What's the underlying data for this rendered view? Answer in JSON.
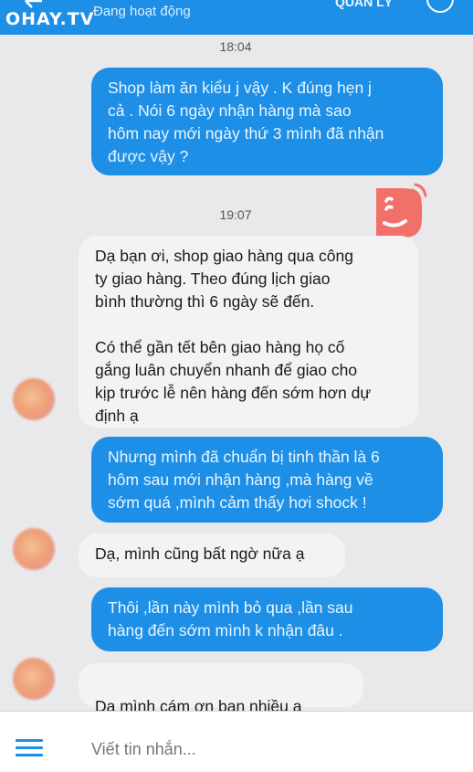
{
  "watermark": "OHAY.TV",
  "header": {
    "status": "Đang hoạt động",
    "manager_label": "QUẢN LÝ"
  },
  "messages": {
    "time1": "18:04",
    "m1": "Shop làm ăn kiểu j vậy . K đúng hẹn j\ncả . Nói 6 ngày nhận hàng mà sao\nhôm nay mới ngày thứ 3 mình đã nhận\nđược vậy ?",
    "time2": "19:07",
    "m2": "Dạ bạn ơi, shop giao hàng qua công\nty giao hàng. Theo đúng lịch giao\nbình thường thì 6 ngày sẽ đến.\n\nCó thể gần tết bên giao hàng họ cố\ngắng luân chuyển nhanh để giao cho\nkịp trước lễ nên hàng đến sớm hơn dự\nđịnh ạ",
    "m3": "Nhưng mình đã chuẩn bị tinh thần là 6\nhôm sau mới nhận hàng ,mà hàng về\nsớm quá ,mình cảm thấy hơi shock !",
    "m4": "Dạ, mình cũng bất ngờ nữa ạ",
    "m5": "Thôi ,lần này mình bỏ qua ,lần sau\nhàng đến sớm mình k nhận đâu .",
    "m6": "Dạ mình cám ơn bạn nhiều ạ",
    "m6_emoji": "❤"
  },
  "composer": {
    "placeholder": "Viết tin nhắn..."
  },
  "colors": {
    "accent": "#1d8fe6",
    "sticker": "#f2706a",
    "heart": "#e0242f"
  },
  "icons": [
    "back-arrow-icon",
    "info-icon",
    "sticker-icon",
    "menu-icon"
  ]
}
